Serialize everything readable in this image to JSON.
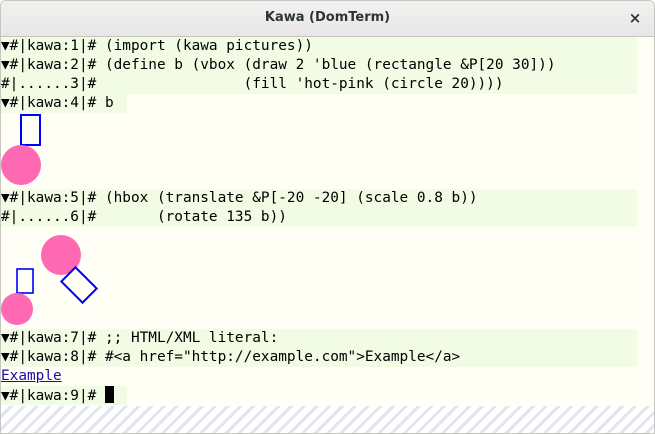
{
  "window": {
    "title": "Kawa (DomTerm)",
    "close_glyph": "×"
  },
  "colors": {
    "blue": "#0000ff",
    "hot_pink": "#ff69b4",
    "input_bg": "#f2fbe4",
    "terminal_bg": "#fffff5",
    "link": "#1a0dab"
  },
  "session": {
    "line1": {
      "prompt": "▼#|kawa:1|# ",
      "code": "(import (kawa pictures))"
    },
    "line2": {
      "prompt": "▼#|kawa:2|# ",
      "code": "(define b (vbox (draw 2 'blue (rectangle &P[20 30]))"
    },
    "line3": {
      "prompt": "#|......3|# ",
      "code": "                (fill 'hot-pink (circle 20))))"
    },
    "line4": {
      "prompt": "▼#|kawa:4|# ",
      "code": "b"
    },
    "line5": {
      "prompt": "▼#|kawa:5|# ",
      "code": "(hbox (translate &P[-20 -20] (scale 0.8 b))"
    },
    "line6": {
      "prompt": "#|......6|# ",
      "code": "      (rotate 135 b))"
    },
    "line7": {
      "prompt": "▼#|kawa:7|# ",
      "code": ";; HTML/XML literal:"
    },
    "line8": {
      "prompt": "▼#|kawa:8|# ",
      "code": "#<a href=\"http://example.com\">Example</a>"
    },
    "link_output": "Example",
    "line9": {
      "prompt": "▼#|kawa:9|# ",
      "code": ""
    }
  }
}
